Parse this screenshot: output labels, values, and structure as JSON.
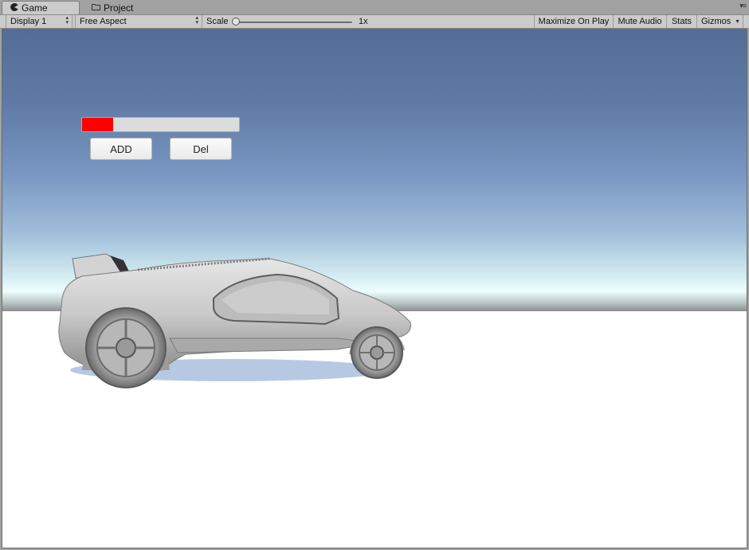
{
  "tabs": [
    {
      "label": "Game",
      "icon": "pacman-icon",
      "active": true
    },
    {
      "label": "Project",
      "icon": "folder-icon",
      "active": false
    }
  ],
  "toolbar": {
    "display": "Display 1",
    "aspect": "Free Aspect",
    "scale_label": "Scale",
    "scale_value": "1x",
    "maximize_on_play": "Maximize On Play",
    "mute_audio": "Mute Audio",
    "stats": "Stats",
    "gizmos": "Gizmos"
  },
  "game_ui": {
    "progress": 0.2,
    "progress_color": "#ff0000",
    "add_button": "ADD",
    "del_button": "Del"
  }
}
